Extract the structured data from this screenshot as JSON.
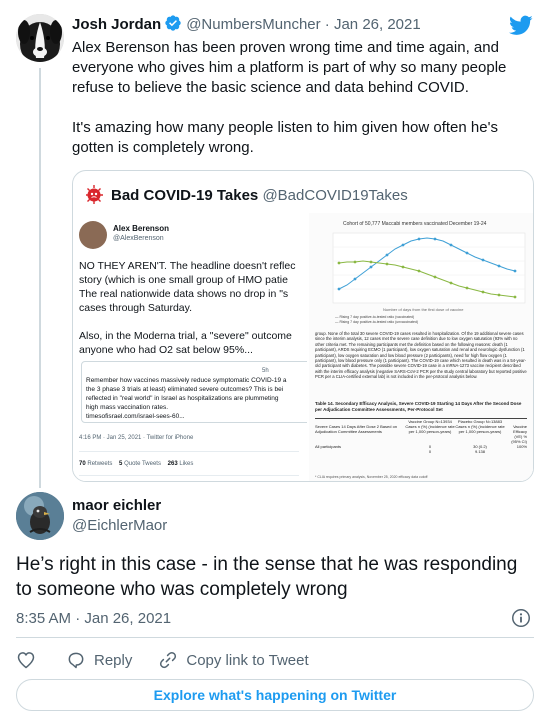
{
  "tweet": {
    "author_name": "Josh Jordan",
    "author_handle": "@NumbersMuncher",
    "separator": "·",
    "date": "Jan 26, 2021",
    "text_p1": "Alex Berenson has been proven wrong time and time again, and everyone who gives him a platform is part of why so many people refuse to believe the basic science and data behind COVID.",
    "text_p2": "It's amazing how many people listen to him given how often he's gotten is completely wrong.",
    "avatar_icon": "dog-avatar",
    "verified_icon": "verified-badge-icon",
    "brand_icon": "twitter-bird-icon"
  },
  "quote": {
    "author_name": "Bad COVID-19 Takes",
    "author_handle": "@BadCOVID19Takes",
    "avatar_icon": "virus-avatar",
    "screenshot": {
      "author_name": "Alex Berenson",
      "author_handle": "@AlexBerenson",
      "body": "NO THEY AREN'T. The headline doesn't reflec\nstory (which is one small group of HMO patie\nThe real nationwide data shows no drop in \"s\ncases through Saturday.\n\nAlso, in the Moderna trial, a \"severe\" outcome\nanyone who had O2 sat below 95%...",
      "card_time": "5h",
      "card_text": "Remember how vaccines massively reduce symptomatic COVID-19 a\nthe 3 phase 3 trials at least) eliminated severe outcomes? This is bei\nreflected in \"real world\" in Israel as hospitalizations are plummeting\nhigh mass vaccination rates.\ntimesofisrael.com/israel-sees-60...",
      "meta": "4:16 PM · Jan 25, 2021 · Twitter for iPhone",
      "retweets_count": "70",
      "retweets_label": "Retweets",
      "quotes_count": "5",
      "quotes_label": "Quote Tweets",
      "likes_count": "263",
      "likes_label": "Likes",
      "chart_title": "Cohort of 50,777 Maccabi members vaccinated December 19-24",
      "chart_caption": "Number of days from the first dose of vaccine",
      "chart_legend": "— Rising 7 day positive-to-tested ratio (vaccinated)\n— Rising 7 day positive-to-tested ratio (unvaccinated)",
      "paper_text": "group. None of the total 30 severe COVID-19 cases resulted in hospitalization. Of the 19 additional severe cases since the interim analysis, 12 cases met the severe case definition due to low oxygen saturation (93% with no other criteria met. The remaining participants met the definition based on the following reasons: death (1 participant), ARDS requiring ECMO (1 participant), low oxygen saturation and renal and neurologic dysfunction (1 participant), low oxygen saturation and low blood pressure (2 participants), need for high flow oxygen (1 participant), low blood pressure only (1 participant). The COVID-19 case which resulted in death was in a 54-year-old participant with diabetes. The possible severe COVID-19 case in a mRNA-1273 vaccine recipient described with the interim efficacy analysis (negative SARS-CoV-2 PCR per the study central laboratory but reported positive PCR per a CLIA-certified external lab) is not included in the per-protocol analysis below.",
      "table_title": "Table 14. Secondary Efficacy Analysis, Severe COVID-19 Starting 14 Days After the Second Dose per Adjudication Committee Assessments, Per-Protocol Set",
      "table_header": [
        "",
        "Vaccine Group N=13934",
        "Placebo Group N=13883",
        ""
      ],
      "table_rows": [
        [
          "Severe Cases 14 Days After Dose 2 Based on Adjudication Committee Assessments",
          "Cases n (%) (incidence rate per 1,000 person-years)",
          "Cases n (%) (incidence rate per 1,000 person-years)",
          "Vaccine Efficacy (VE) % (95% CI)"
        ],
        [
          "All participants",
          "0",
          "30 (0.2)",
          "100%"
        ],
        [
          "",
          "0",
          "9.138",
          ""
        ]
      ],
      "paper_footnote": "* CLIA requires primary analysis, November 25, 2020 efficacy data cutoff"
    }
  },
  "reply": {
    "author_name": "maor eichler",
    "author_handle": "@EichlerMaor",
    "avatar_icon": "bird-avatar",
    "text": "He’s right in this case - in the sense that he was responding to someone who was completely wrong",
    "timestamp": "8:35 AM · Jan 26, 2021",
    "info_icon": "info-icon"
  },
  "actions": {
    "like_icon": "heart-icon",
    "reply_icon": "reply-bubble-icon",
    "reply_label": "Reply",
    "copy_icon": "link-icon",
    "copy_label": "Copy link to Tweet"
  },
  "footer": {
    "explore_label": "Explore what's happening on Twitter"
  },
  "colors": {
    "twitter_blue": "#1d9bf0",
    "text_primary": "#0f1419",
    "text_secondary": "#536471",
    "border": "#cfd9de",
    "chart_blue": "#3fa0d6",
    "chart_green": "#8ab843"
  }
}
